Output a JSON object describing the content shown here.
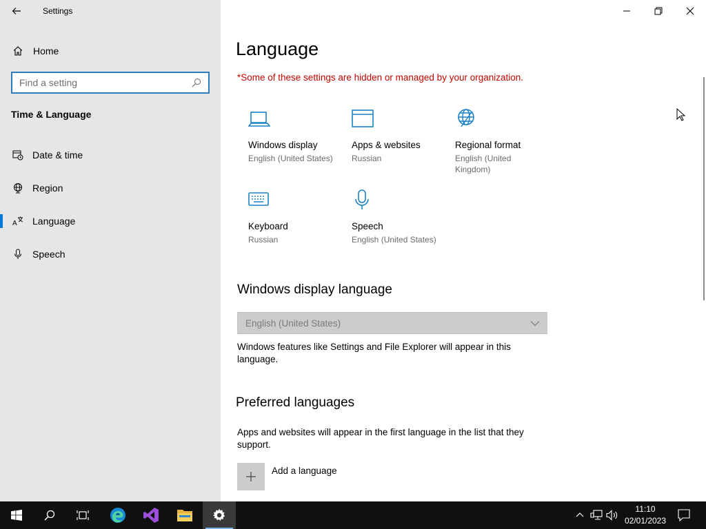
{
  "window": {
    "title": "Settings"
  },
  "sidebar": {
    "home_label": "Home",
    "search_placeholder": "Find a setting",
    "section_title": "Time & Language",
    "items": [
      {
        "label": "Date & time",
        "icon": "calendar-clock-icon"
      },
      {
        "label": "Region",
        "icon": "globe-icon"
      },
      {
        "label": "Language",
        "icon": "language-icon",
        "active": true
      },
      {
        "label": "Speech",
        "icon": "microphone-icon"
      }
    ]
  },
  "main": {
    "title": "Language",
    "warning": "*Some of these settings are hidden or managed by your organization.",
    "tiles": [
      {
        "label": "Windows display",
        "sub": "English (United States)",
        "icon": "laptop-icon"
      },
      {
        "label": "Apps & websites",
        "sub": "Russian",
        "icon": "browser-window-icon"
      },
      {
        "label": "Regional format",
        "sub": "English (United Kingdom)",
        "icon": "globe-format-icon"
      },
      {
        "label": "Keyboard",
        "sub": "Russian",
        "icon": "keyboard-icon"
      },
      {
        "label": "Speech",
        "sub": "English (United States)",
        "icon": "microphone-icon"
      }
    ],
    "display_language_heading": "Windows display language",
    "display_language_value": "English (United States)",
    "display_language_desc": "Windows features like Settings and File Explorer will appear in this language.",
    "preferred_heading": "Preferred languages",
    "preferred_desc": "Apps and websites will appear in the first language in the list that they support.",
    "add_language_label": "Add a language"
  },
  "taskbar": {
    "time": "11:10",
    "date": "02/01/2023",
    "apps": [
      "start-icon",
      "search-icon",
      "task-view-icon",
      "edge-icon",
      "visual-studio-icon",
      "file-explorer-icon",
      "settings-gear-icon"
    ]
  },
  "colors": {
    "accent": "#0078d7",
    "warning": "#c50500",
    "sidebar_bg": "#e6e6e6",
    "taskbar_bg": "#101010"
  }
}
